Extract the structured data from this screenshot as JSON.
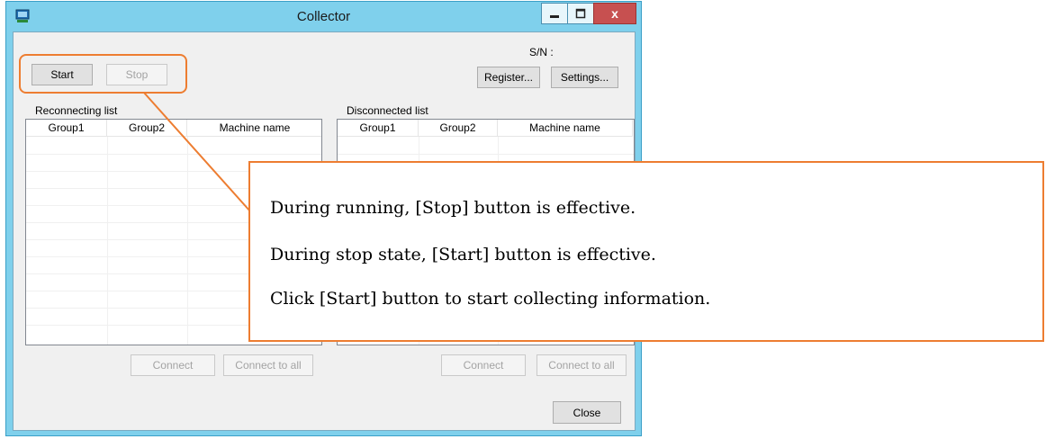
{
  "window": {
    "title": "Collector"
  },
  "controls": {
    "close_glyph": "x"
  },
  "serial": {
    "label": "S/N :"
  },
  "buttons": {
    "start": "Start",
    "stop": "Stop",
    "register": "Register...",
    "settings": "Settings...",
    "close": "Close"
  },
  "reconnecting": {
    "title": "Reconnecting list",
    "columns": [
      "Group1",
      "Group2",
      "Machine name"
    ],
    "connect": "Connect",
    "connect_all": "Connect to all"
  },
  "disconnected": {
    "title": "Disconnected list",
    "columns": [
      "Group1",
      "Group2",
      "Machine name"
    ],
    "connect": "Connect",
    "connect_all": "Connect to all"
  },
  "callout": {
    "lines": [
      "During running, [Stop] button is effective.",
      "During stop state, [Start] button is effective.",
      "Click [Start] button to start collecting information."
    ]
  },
  "colors": {
    "accent": "#ed7d31",
    "titlebar": "#7fd0ec",
    "close": "#c75050"
  }
}
